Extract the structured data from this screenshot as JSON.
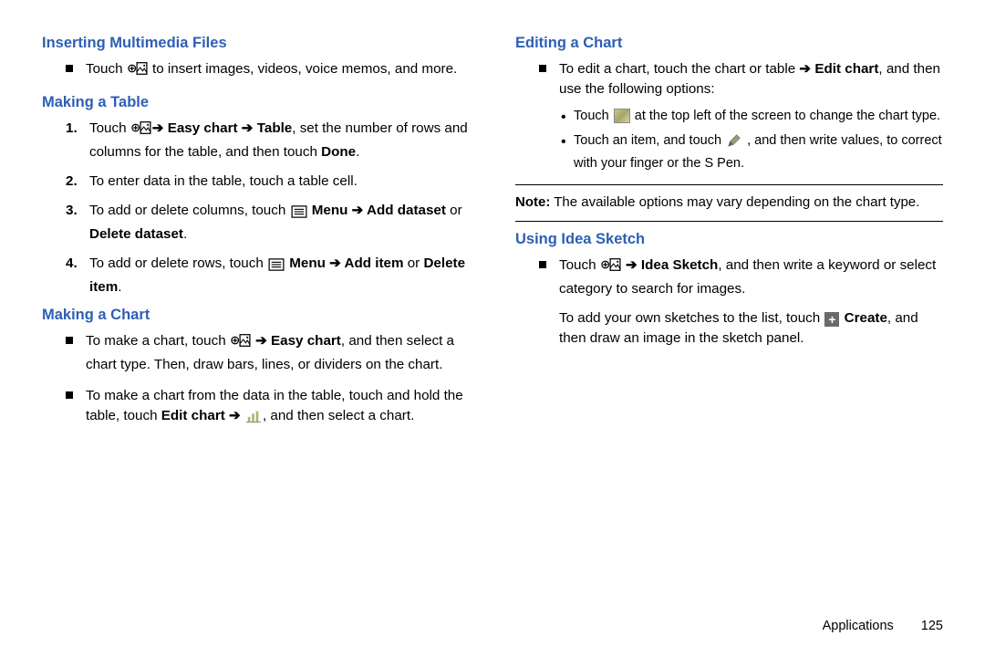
{
  "col1": {
    "h1": "Inserting Multimedia Files",
    "p1a": "Touch ",
    "p1b": " to insert images, videos, voice memos, and more.",
    "h2": "Making a Table",
    "t1a": "Touch ",
    "t1b": " ",
    "t1arrow1": "➔",
    "t1easy": " Easy chart ",
    "t1arrow2": "➔",
    "t1table": " Table",
    "t1c": ", set the number of rows and columns for the table, and then touch ",
    "t1done": "Done",
    "t1d": ".",
    "t2": "To enter data in the table, touch a table cell.",
    "t3a": "To add or delete columns, touch ",
    "t3menu": " Menu ",
    "t3arrow": "➔",
    "t3add": " Add dataset",
    "t3or": " or ",
    "t3del": "Delete dataset",
    "t3d": ".",
    "t4a": "To add or delete rows, touch ",
    "t4menu": " Menu ",
    "t4arrow": "➔",
    "t4add": " Add item",
    "t4or": " or ",
    "t4del": "Delete item",
    "t4d": ".",
    "h3": "Making a Chart",
    "c1a": "To make a chart, touch ",
    "c1arrow": " ➔",
    "c1easy": " Easy chart",
    "c1b": ", and then select a chart type. Then, draw bars, lines, or dividers on the chart.",
    "c2a": "To make a chart from the data in the table, touch and hold the table, touch ",
    "c2edit": "Edit chart ",
    "c2arrow": "➔ ",
    "c2b": ", and then select a chart.",
    "c2icon": " "
  },
  "col2": {
    "h1": "Editing a Chart",
    "e1a": "To edit a chart, touch the chart or table ",
    "e1arrow": "➔",
    "e1editchart": " Edit chart",
    "e1b": ", and then use the following options:",
    "e2a": "Touch ",
    "e2b": " at the top left of the screen to change the chart type.",
    "e3a": "Touch an item, and touch ",
    "e3b": " , and then write values, to correct with your finger or the S Pen.",
    "noteLabel": "Note:",
    "noteText": " The available options may vary depending on the chart type.",
    "h2": "Using Idea Sketch",
    "i1a": "Touch ",
    "i1arrow": " ➔",
    "i1idea": " Idea Sketch",
    "i1b": ", and then write a keyword or select category to search for images.",
    "i2a": "To add your own sketches to the list, touch ",
    "i2create": " Create",
    "i2b": ", and then draw an image in the sketch panel."
  },
  "footer": {
    "section": "Applications",
    "page": "125"
  }
}
